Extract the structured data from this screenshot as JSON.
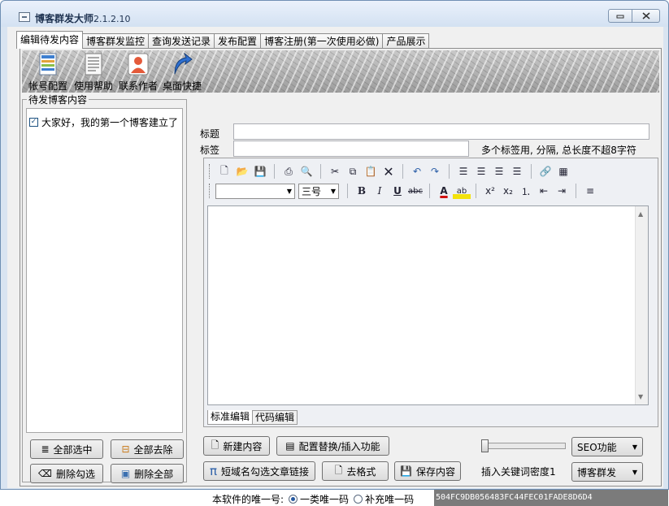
{
  "window": {
    "title": "博客群发大师",
    "version": "2.1.2.10",
    "minimize_icon": "minimize-icon",
    "close_icon": "close-icon"
  },
  "tabs": [
    {
      "label": "编辑待发内容",
      "active": true
    },
    {
      "label": "博客群发监控"
    },
    {
      "label": "查询发送记录"
    },
    {
      "label": "发布配置"
    },
    {
      "label": "博客注册(第一次使用必做)"
    },
    {
      "label": "产品展示"
    }
  ],
  "toolbar": [
    {
      "label": "帐号配置",
      "icon": "account-config-icon"
    },
    {
      "label": "使用帮助",
      "icon": "help-document-icon"
    },
    {
      "label": "联系作者",
      "icon": "contact-person-icon"
    },
    {
      "label": "桌面快捷",
      "icon": "desktop-shortcut-icon"
    }
  ],
  "left_panel": {
    "title": "待发博客内容",
    "items": [
      {
        "label": "大家好，我的第一个博客建立了",
        "checked": true
      }
    ],
    "buttons": {
      "select_all": "全部选中",
      "unselect_all": "全部去除",
      "delete_checked": "删除勾选",
      "delete_all": "删除全部"
    }
  },
  "form": {
    "title_label": "标题",
    "title_value": "",
    "tag_label": "标签",
    "tag_value": "",
    "tag_hint": "多个标签用, 分隔, 总长度不超8字符"
  },
  "editor": {
    "font_name": "",
    "font_size": "三号",
    "mode_tabs": [
      {
        "label": "标准编辑",
        "active": true
      },
      {
        "label": "代码编辑"
      }
    ]
  },
  "actions": {
    "new_content": "新建内容",
    "config_replace": "配置替换/插入功能",
    "short_domain": "短域名勾选文章链接",
    "remove_format": "去格式",
    "save_content": "保存内容",
    "seo": "SEO功能",
    "blog_send": "博客群发"
  },
  "density": {
    "label": "插入关键词密度1",
    "value": 1
  },
  "unique": {
    "label": "本软件的唯一号:",
    "option1": "一类唯一码",
    "option2": "补充唯一码",
    "selected": "一类唯一码",
    "code": "504FC9DB056483FC44FEC01FADE8D6D4"
  },
  "colors": {
    "title_bar": "#d3e1f2",
    "accent": "#2458a0",
    "code_bg": "#7b7b7b"
  }
}
